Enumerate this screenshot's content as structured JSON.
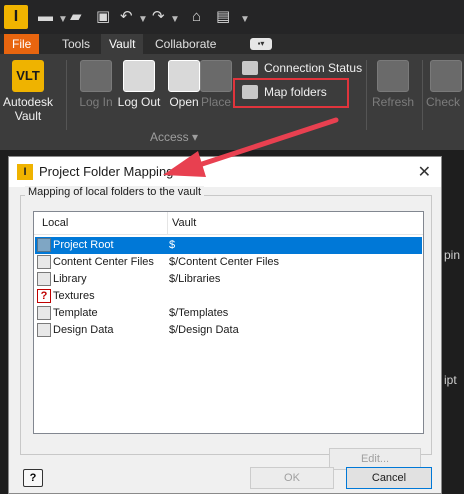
{
  "qat": {
    "app_letter": "I"
  },
  "ribbon": {
    "tabs": [
      {
        "label": "File"
      },
      {
        "label": "Tools"
      },
      {
        "label": "Vault"
      },
      {
        "label": "Collaborate"
      }
    ],
    "buttons": {
      "autodesk_vault_line1": "Autodesk",
      "autodesk_vault_line2": "Vault",
      "vault_icon_text": "VLT",
      "log_in": "Log In",
      "log_out": "Log Out",
      "open": "Open",
      "place": "Place",
      "connection_status": "Connection Status",
      "map_folders": "Map folders",
      "refresh": "Refresh",
      "check": "Check"
    },
    "group_label": "Access ▾",
    "cut_text_1": "pin",
    "cut_text_2": "ipt"
  },
  "dialog": {
    "title": "Project Folder Mapping",
    "title_icon_letter": "I",
    "close_glyph": "✕",
    "group_caption": "Mapping of local folders to the vault",
    "columns": {
      "local": "Local",
      "vault": "Vault"
    },
    "rows": [
      {
        "local": "Project Root",
        "vault": "$",
        "icon": "folder-icon",
        "selected": true
      },
      {
        "local": "Content Center Files",
        "vault": "$/Content Center Files",
        "icon": "library-icon",
        "selected": false
      },
      {
        "local": "Library",
        "vault": "$/Libraries",
        "icon": "library-icon",
        "selected": false
      },
      {
        "local": "Textures",
        "vault": "",
        "icon": "missing-icon",
        "selected": false
      },
      {
        "local": "Template",
        "vault": "$/Templates",
        "icon": "library-icon",
        "selected": false
      },
      {
        "local": "Design Data",
        "vault": "$/Design Data",
        "icon": "library-icon",
        "selected": false
      }
    ],
    "edit_button": "Edit...",
    "ok_button": "OK",
    "cancel_button": "Cancel",
    "help_glyph": "?"
  },
  "colors": {
    "accent": "#0078d7",
    "file_tab": "#e8650f",
    "highlight": "#e0343c",
    "arrow": "#e84050"
  }
}
